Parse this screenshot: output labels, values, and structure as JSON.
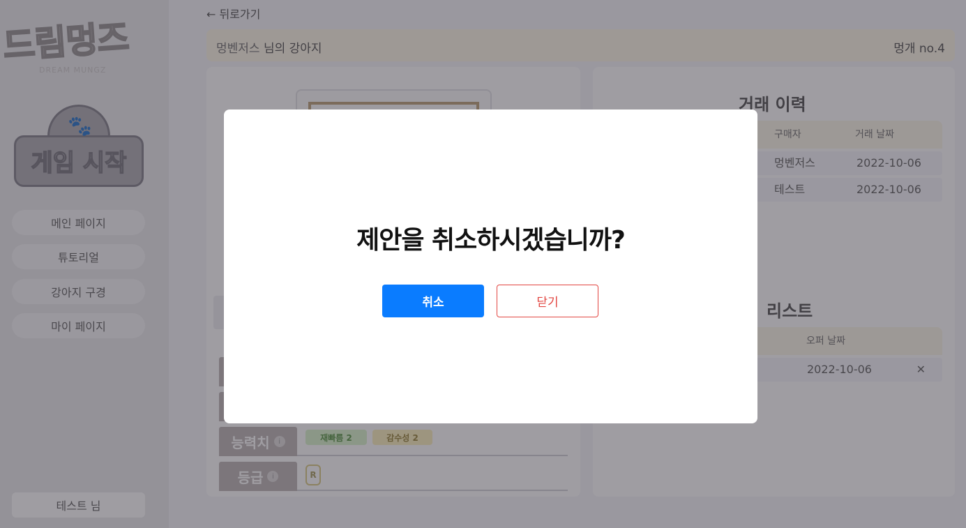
{
  "sidebar": {
    "logo_text": "드림멍즈",
    "logo_sub": "DREAM MUNGZ",
    "start_label": "게임 시작",
    "nav": [
      {
        "label": "메인 페이지"
      },
      {
        "label": "튜토리얼"
      },
      {
        "label": "강아지 구경"
      },
      {
        "label": "마이 페이지"
      }
    ],
    "user_label": "테스트 님"
  },
  "main": {
    "back_label": "← 뒤로가기",
    "owner_name": "멍벤저스",
    "owner_suffix": " 님의 강아지",
    "dog_no": "멍개 no.4",
    "stats": {
      "ability_label": "능력치",
      "grade_label": "등급",
      "ability_tags": [
        "재빠름 2",
        "감수성 2"
      ],
      "grade_value": "R"
    },
    "trade_history": {
      "title": "거래 이력",
      "columns": [
        "구매자",
        "거래 날짜"
      ],
      "rows": [
        {
          "buyer": "멍벤저스",
          "date": "2022-10-06"
        },
        {
          "buyer": "테스트",
          "date": "2022-10-06"
        }
      ]
    },
    "offer_list": {
      "title": "리스트",
      "columns": [
        "오퍼 날짜"
      ],
      "rows": [
        {
          "date": "2022-10-06"
        }
      ]
    }
  },
  "modal": {
    "title": "제안을 취소하시겠습니까?",
    "confirm_label": "취소",
    "close_label": "닫기"
  },
  "colors": {
    "primary": "#0a7cff",
    "danger": "#e2433e",
    "delete_mark": "#e4709a"
  }
}
